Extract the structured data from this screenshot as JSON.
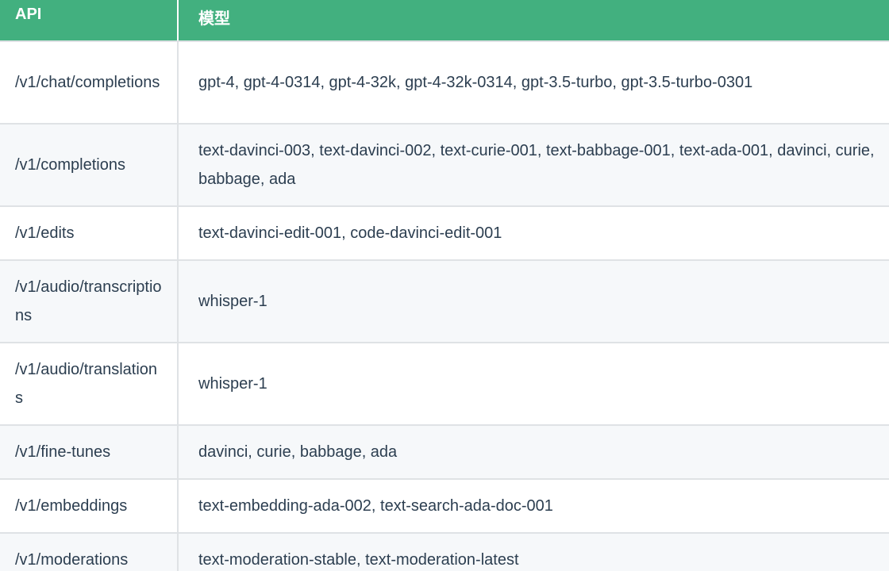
{
  "colors": {
    "header_bg": "#42b07f",
    "header_text": "#ffffff",
    "row_alt_bg": "#f6f8fa",
    "border": "#dfe2e5",
    "text": "#2c3e50"
  },
  "table": {
    "headers": [
      "API",
      "模型"
    ],
    "rows": [
      {
        "api": "/v1/chat/completions",
        "models": "gpt-4, gpt-4-0314, gpt-4-32k, gpt-4-32k-0314, gpt-3.5-turbo, gpt-3.5-turbo-0301"
      },
      {
        "api": "/v1/completions",
        "models": "text-davinci-003, text-davinci-002, text-curie-001, text-babbage-001, text-ada-001, davinci, curie, babbage, ada"
      },
      {
        "api": "/v1/edits",
        "models": "text-davinci-edit-001, code-davinci-edit-001"
      },
      {
        "api": "/v1/audio/transcriptions",
        "models": "whisper-1"
      },
      {
        "api": "/v1/audio/translations",
        "models": "whisper-1"
      },
      {
        "api": "/v1/fine-tunes",
        "models": "davinci, curie, babbage, ada"
      },
      {
        "api": "/v1/embeddings",
        "models": "text-embedding-ada-002, text-search-ada-doc-001"
      },
      {
        "api": "/v1/moderations",
        "models": "text-moderation-stable, text-moderation-latest"
      }
    ]
  }
}
